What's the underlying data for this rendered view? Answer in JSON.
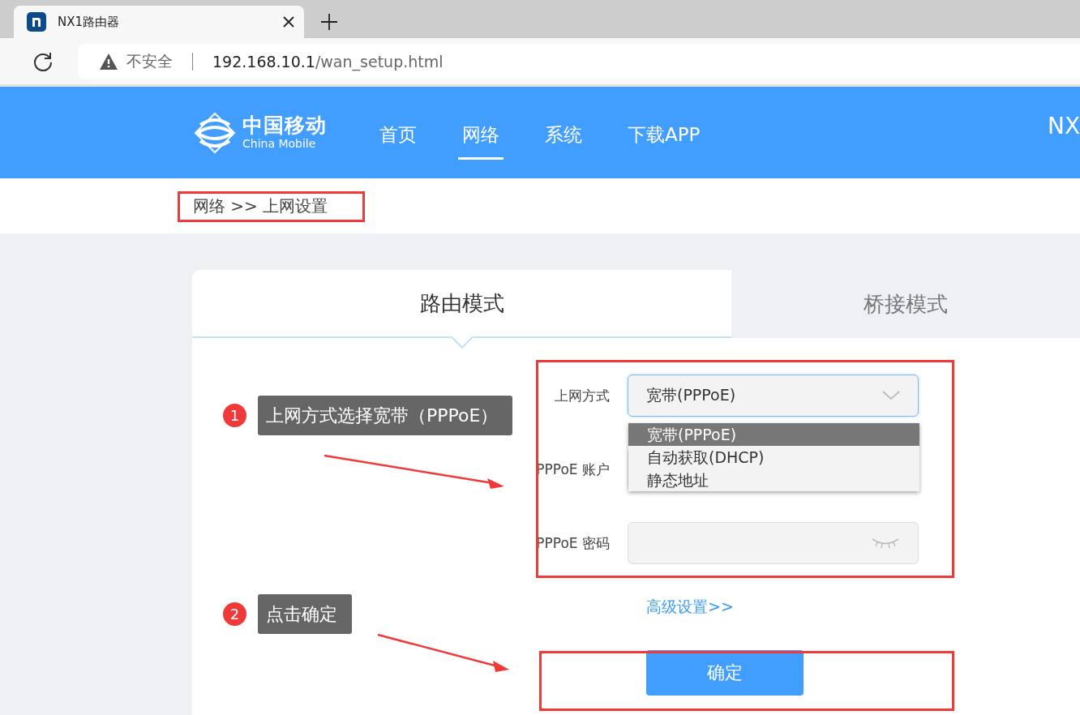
{
  "browser": {
    "tab_title": "NX1路由器",
    "security_label": "不安全",
    "url_host": "192.168.10.1",
    "url_path": "/wan_setup.html"
  },
  "header": {
    "logo_cn": "中国移动",
    "logo_en": "China Mobile",
    "nav": [
      {
        "label": "首页",
        "selected": false
      },
      {
        "label": "网络",
        "selected": true
      },
      {
        "label": "系统",
        "selected": false
      },
      {
        "label": "下载APP",
        "selected": false
      }
    ],
    "model": "NX"
  },
  "breadcrumb": "网络 >> 上网设置",
  "mode_tabs": [
    {
      "label": "路由模式",
      "selected": true
    },
    {
      "label": "桥接模式",
      "selected": false
    }
  ],
  "form": {
    "fields": [
      {
        "kind": "select",
        "label": "上网方式",
        "value": "宽带(PPPoE)",
        "expanded": true,
        "options": [
          {
            "label": "宽带(PPPoE)",
            "selected": true
          },
          {
            "label": "自动获取(DHCP)",
            "selected": false
          },
          {
            "label": "静态地址",
            "selected": false
          }
        ]
      },
      {
        "kind": "text",
        "label": "PPPoE 账户"
      },
      {
        "kind": "password",
        "label": "PPPoE 密码"
      }
    ],
    "advanced_link": "高级设置>>",
    "submit": "确定"
  },
  "annotations": {
    "steps": [
      {
        "number": "1",
        "text": "上网方式选择宽带（PPPoE）"
      },
      {
        "number": "2",
        "text": "点击确定"
      }
    ]
  }
}
